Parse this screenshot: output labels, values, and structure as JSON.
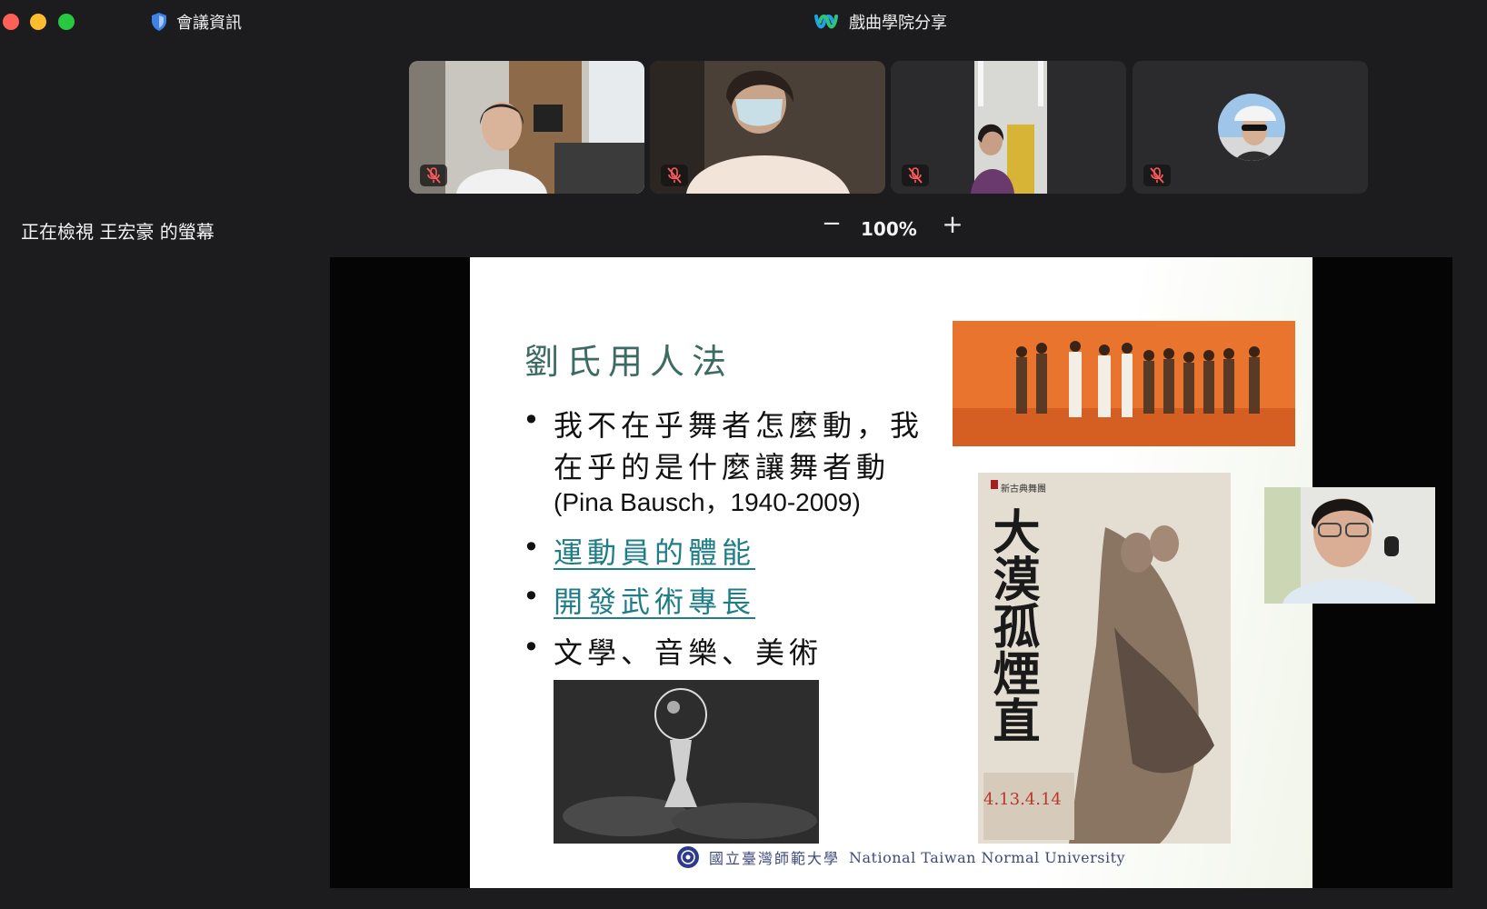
{
  "titlebar": {
    "meeting_info_label": "會議資訊",
    "window_title": "戲曲學院分享"
  },
  "participants": [
    {
      "tile": "participant-1",
      "muted": true
    },
    {
      "tile": "participant-2",
      "muted": true
    },
    {
      "tile": "participant-3",
      "muted": true
    },
    {
      "tile": "participant-4",
      "muted": true
    }
  ],
  "viewing_bar": {
    "viewing_label": "正在檢視 王宏豪 的螢幕",
    "zoom_minus": "−",
    "zoom_level": "100%",
    "zoom_plus": "+"
  },
  "slide": {
    "title": "劉氏用人法",
    "bullet_glyph": "•",
    "bullet1_line1": "我不在乎舞者怎麼動，我",
    "bullet1_line2": "在乎的是什麼讓舞者動",
    "bullet1_citation": "(Pina Bausch，1940-2009)",
    "bullet2_link": "運動員的體能",
    "bullet3_link": "開發武術專長",
    "bullet4": "文學、音樂、美術",
    "poster": {
      "title_calligraphy": "大漠孤煙直",
      "company": "新古典舞團",
      "dates": "4.13.4.14"
    },
    "footer": {
      "university_zh": "國立臺灣師範大學",
      "university_en": "National Taiwan Normal University"
    }
  },
  "colors": {
    "background": "#1c1c1e",
    "slide_title": "#3d6a62",
    "link": "#1f7d88",
    "footer_text": "#404a7a"
  },
  "icons": {
    "meeting_info": "shield-icon",
    "app_logo": "webex-logo-icon",
    "mute": "mic-muted-icon"
  }
}
